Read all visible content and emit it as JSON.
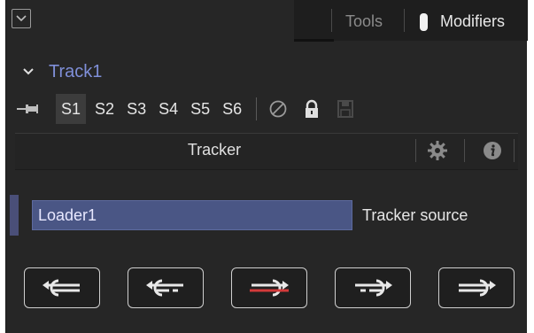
{
  "header": {
    "tabs": [
      {
        "label": "Tools",
        "active": false
      },
      {
        "label": "Modifiers",
        "active": true
      }
    ],
    "icons": [
      "collapse-icon"
    ]
  },
  "track": {
    "name": "Track1",
    "expanded": true
  },
  "versions": {
    "items": [
      "S1",
      "S2",
      "S3",
      "S4",
      "S5",
      "S6"
    ],
    "active": "S1",
    "icons": [
      "pin-icon",
      "disable-icon",
      "lock-icon",
      "save-icon"
    ]
  },
  "tracker_bar": {
    "label": "Tracker",
    "icons": [
      "gear-icon",
      "info-icon"
    ]
  },
  "source": {
    "value": "Loader1",
    "label": "Tracker source"
  },
  "track_buttons": [
    {
      "icon": "track-reverse-icon"
    },
    {
      "icon": "track-reverse-from-frame-icon"
    },
    {
      "icon": "stop-tracking-icon"
    },
    {
      "icon": "track-forward-from-frame-icon"
    },
    {
      "icon": "track-forward-icon"
    }
  ],
  "colors": {
    "background": "#262626",
    "accent": "#7f8fd8",
    "input_bg": "#4a5685",
    "stop_red": "#d23a3a"
  }
}
